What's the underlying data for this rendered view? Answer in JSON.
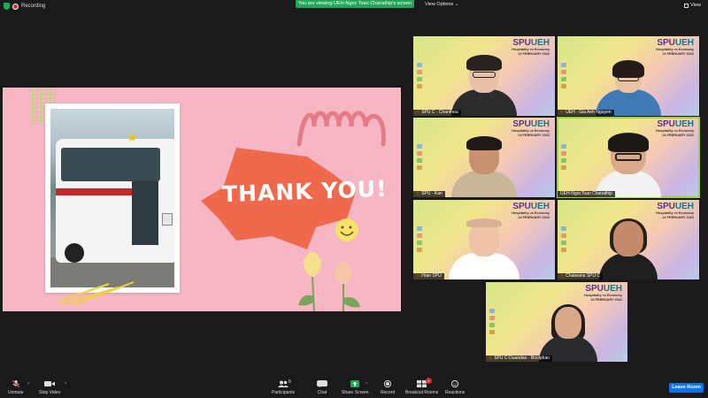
{
  "top": {
    "recording": "Recording",
    "banner": "You are viewing UEH-Ngoc Toan Chanathip's screen",
    "view_options": "View Options",
    "view": "View"
  },
  "slide": {
    "text": "THANK YOU!"
  },
  "branding": {
    "brand_a": "SPU",
    "brand_b": "UEH",
    "line1": "Hospitality vs Economy",
    "line2": "24 FEBRUARY 2022"
  },
  "participants": [
    {
      "name": "SPU C - Chanthou",
      "muted": true
    },
    {
      "name": "UEH - Gia Anh Nguyen",
      "muted": true
    },
    {
      "name": "SPU - Kan",
      "muted": true
    },
    {
      "name": "UEH-NgocToan Chanathip",
      "muted": false
    },
    {
      "name": "Hran SPU",
      "muted": true
    },
    {
      "name": "Chaiwana SPU C",
      "muted": true
    },
    {
      "name": "SPU C-Duandao - Boolphan",
      "muted": true
    }
  ],
  "toolbar": {
    "unmute": "Unmute",
    "stop_video": "Stop Video",
    "participants": "Participants",
    "participants_count": "8",
    "chat": "Chat",
    "share_screen": "Share Screen",
    "record": "Record",
    "breakout": "Breakout Rooms",
    "reactions": "Reactions",
    "leave": "Leave Room"
  },
  "colors": {
    "zoom_green": "#23a55a",
    "leave_blue": "#0e72ed",
    "slide_pink": "#f6b6c4",
    "accent_orange": "#ef6a4c"
  }
}
